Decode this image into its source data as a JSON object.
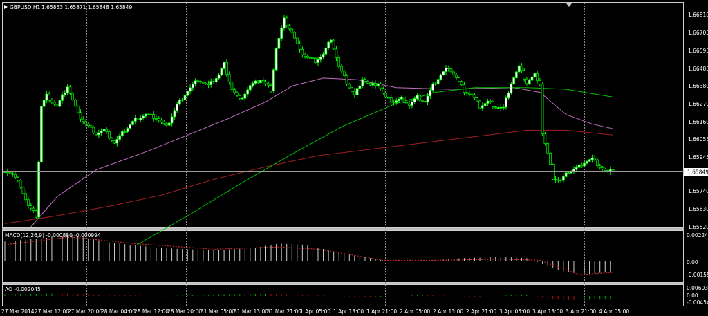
{
  "window": {
    "symbol": "GBPUSD,H1",
    "ohlc": "1.65853 1.65871 1.65848 1.65849"
  },
  "main_panel": {
    "price_ticks": [
      "1.66810",
      "1.66705",
      "1.66595",
      "1.66485",
      "1.66380",
      "1.66270",
      "1.66160",
      "1.66055",
      "1.65945",
      "1.65740",
      "1.65630",
      "1.65520"
    ],
    "current_price": "1.65849",
    "colors": {
      "background": "#000000",
      "candles": "#00ff00",
      "bull_body": "#ffffff",
      "grid": "#8a8a8a",
      "ma_fast": "#00c000",
      "ma_mid": "#c070c0",
      "ma_slow": "#a02020"
    }
  },
  "macd_panel": {
    "label": "MACD(12,26,9) -0.000880 -0.000994",
    "ticks": [
      "0.002245",
      "0.00",
      "-0.00155"
    ]
  },
  "ao_panel": {
    "label": "AO -0.002045",
    "ticks": [
      "0.006032",
      "0.00",
      "-0.00454"
    ]
  },
  "time_axis": [
    "27 Mar 2014",
    "27 Mar 12:00",
    "27 Mar 20:00",
    "28 Mar 04:00",
    "28 Mar 12:00",
    "28 Mar 20:00",
    "31 Mar 05:00",
    "31 Mar 13:00",
    "31 Mar 21:00",
    "1 Apr 05:00",
    "1 Apr 13:00",
    "1 Apr 21:00",
    "2 Apr 05:00",
    "2 Apr 13:00",
    "2 Apr 21:00",
    "3 Apr 05:00",
    "3 Apr 13:00",
    "3 Apr 21:00",
    "4 Apr 05:00"
  ],
  "chart_data": {
    "type": "candlestick",
    "price_ylim": [
      1.6549,
      1.6688
    ],
    "close_path": [
      [
        0,
        1.6585
      ],
      [
        3,
        1.6582
      ],
      [
        6,
        1.6575
      ],
      [
        9,
        1.6562
      ],
      [
        12,
        1.6556
      ],
      [
        14,
        1.6625
      ],
      [
        16,
        1.6632
      ],
      [
        20,
        1.6625
      ],
      [
        24,
        1.6638
      ],
      [
        28,
        1.662
      ],
      [
        31,
        1.6614
      ],
      [
        35,
        1.6608
      ],
      [
        38,
        1.661
      ],
      [
        42,
        1.6602
      ],
      [
        46,
        1.661
      ],
      [
        50,
        1.6617
      ],
      [
        54,
        1.662
      ],
      [
        58,
        1.6618
      ],
      [
        62,
        1.6612
      ],
      [
        66,
        1.6626
      ],
      [
        70,
        1.6635
      ],
      [
        74,
        1.6642
      ],
      [
        78,
        1.6638
      ],
      [
        82,
        1.6645
      ],
      [
        84,
        1.6652
      ],
      [
        87,
        1.6636
      ],
      [
        90,
        1.6629
      ],
      [
        94,
        1.6638
      ],
      [
        98,
        1.6642
      ],
      [
        102,
        1.6636
      ],
      [
        104,
        1.6662
      ],
      [
        107,
        1.668
      ],
      [
        110,
        1.6672
      ],
      [
        113,
        1.666
      ],
      [
        116,
        1.6656
      ],
      [
        119,
        1.6654
      ],
      [
        122,
        1.6658
      ],
      [
        125,
        1.6668
      ],
      [
        128,
        1.665
      ],
      [
        131,
        1.664
      ],
      [
        134,
        1.6632
      ],
      [
        137,
        1.6643
      ],
      [
        140,
        1.6638
      ],
      [
        143,
        1.664
      ],
      [
        146,
        1.663
      ],
      [
        149,
        1.6628
      ],
      [
        152,
        1.663
      ],
      [
        155,
        1.6626
      ],
      [
        158,
        1.6631
      ],
      [
        161,
        1.6628
      ],
      [
        164,
        1.6638
      ],
      [
        167,
        1.6645
      ],
      [
        170,
        1.665
      ],
      [
        173,
        1.6643
      ],
      [
        176,
        1.6635
      ],
      [
        179,
        1.6632
      ],
      [
        182,
        1.6625
      ],
      [
        185,
        1.6628
      ],
      [
        188,
        1.6625
      ],
      [
        191,
        1.6624
      ],
      [
        194,
        1.664
      ],
      [
        197,
        1.665
      ],
      [
        200,
        1.664
      ],
      [
        203,
        1.6645
      ],
      [
        205,
        1.664
      ],
      [
        206,
        1.6608
      ],
      [
        208,
        1.6595
      ],
      [
        210,
        1.658
      ],
      [
        213,
        1.6578
      ],
      [
        216,
        1.6584
      ],
      [
        219,
        1.6586
      ],
      [
        222,
        1.659
      ],
      [
        225,
        1.6592
      ],
      [
        228,
        1.6587
      ],
      [
        231,
        1.6583
      ],
      [
        233,
        1.6585
      ]
    ],
    "ma_fast": [
      [
        50,
        1.6537
      ],
      [
        70,
        1.6556
      ],
      [
        90,
        1.6576
      ],
      [
        110,
        1.6595
      ],
      [
        130,
        1.6613
      ],
      [
        150,
        1.6627
      ],
      [
        165,
        1.6634
      ],
      [
        180,
        1.6637
      ],
      [
        200,
        1.6637
      ],
      [
        215,
        1.6636
      ],
      [
        233,
        1.6631
      ]
    ],
    "ma_mid": [
      [
        10,
        1.6549
      ],
      [
        20,
        1.6568
      ],
      [
        35,
        1.6585
      ],
      [
        55,
        1.6597
      ],
      [
        70,
        1.6607
      ],
      [
        85,
        1.6617
      ],
      [
        100,
        1.6628
      ],
      [
        110,
        1.6638
      ],
      [
        122,
        1.6643
      ],
      [
        135,
        1.6642
      ],
      [
        150,
        1.6637
      ],
      [
        170,
        1.6636
      ],
      [
        195,
        1.6637
      ],
      [
        205,
        1.6634
      ],
      [
        215,
        1.662
      ],
      [
        225,
        1.6614
      ],
      [
        233,
        1.6611
      ]
    ],
    "ma_slow": [
      [
        0,
        1.6551
      ],
      [
        20,
        1.6556
      ],
      [
        40,
        1.6562
      ],
      [
        60,
        1.6569
      ],
      [
        80,
        1.6579
      ],
      [
        100,
        1.6587
      ],
      [
        120,
        1.6594
      ],
      [
        140,
        1.6598
      ],
      [
        160,
        1.6602
      ],
      [
        180,
        1.6606
      ],
      [
        200,
        1.661
      ],
      [
        215,
        1.661
      ],
      [
        233,
        1.6607
      ]
    ],
    "macd_hist": [
      [
        0,
        0.0018
      ],
      [
        15,
        0.0021
      ],
      [
        25,
        0.0024
      ],
      [
        40,
        0.0017
      ],
      [
        60,
        0.0012
      ],
      [
        80,
        0.001
      ],
      [
        95,
        0.0012
      ],
      [
        105,
        0.0016
      ],
      [
        115,
        0.0015
      ],
      [
        130,
        0.0007
      ],
      [
        145,
        0.0001
      ],
      [
        160,
        0.0
      ],
      [
        175,
        0.0003
      ],
      [
        190,
        0.0004
      ],
      [
        200,
        0.0003
      ],
      [
        212,
        -0.0008
      ],
      [
        222,
        -0.0012
      ],
      [
        233,
        -0.0009
      ]
    ],
    "macd_signal": [
      [
        0,
        0.0015
      ],
      [
        25,
        0.0022
      ],
      [
        50,
        0.0016
      ],
      [
        80,
        0.0011
      ],
      [
        105,
        0.0013
      ],
      [
        120,
        0.0011
      ],
      [
        145,
        0.0001
      ],
      [
        165,
        0.0001
      ],
      [
        190,
        0.0002
      ],
      [
        205,
        0.0001
      ],
      [
        220,
        -0.0012
      ],
      [
        233,
        -0.001
      ]
    ],
    "ao_values": [
      [
        0,
        0.0015
      ],
      [
        20,
        0.002
      ],
      [
        40,
        0.001
      ],
      [
        60,
        -0.0002
      ],
      [
        80,
        0.0012
      ],
      [
        100,
        0.0018
      ],
      [
        120,
        0.0005
      ],
      [
        140,
        -0.001
      ],
      [
        160,
        0.0008
      ],
      [
        180,
        -0.0005
      ],
      [
        200,
        0.001
      ],
      [
        210,
        -0.0025
      ],
      [
        220,
        -0.0035
      ],
      [
        233,
        -0.002
      ]
    ]
  }
}
